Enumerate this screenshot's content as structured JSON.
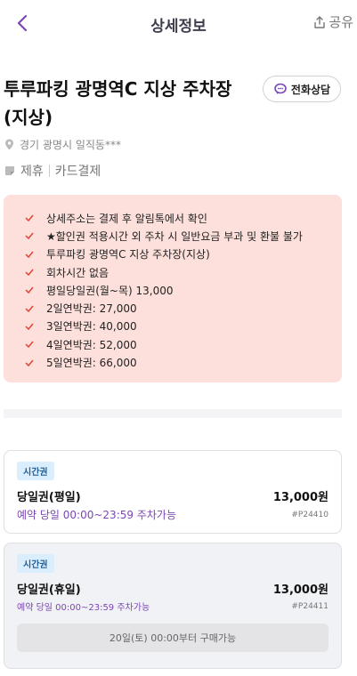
{
  "header": {
    "title": "상세정보",
    "share_label": "공유"
  },
  "lot": {
    "title_line1": "투루파킹 광명역C 지상 주차장",
    "title_line2": "(지상)",
    "call_label": "전화상담",
    "address": "경기 광명시 일직동***",
    "tags": [
      "제휴",
      "카드결제"
    ]
  },
  "notices": [
    "상세주소는 결제 후 알림톡에서 확인",
    "★할인권 적용시간 외 주차 시 일반요금 부과 및 환불 불가",
    "투루파킹 광명역C 지상 주차장(지상)",
    "회차시간 없음",
    "평일당일권(월~목) 13,000",
    "2일연박권: 27,000",
    "3일연박권: 40,000",
    "4일연박권: 52,000",
    "5일연박권: 66,000"
  ],
  "tickets": [
    {
      "chip": "시간권",
      "name": "당일권(평일)",
      "price": "13,000원",
      "time": "예약 당일 00:00~23:59 주차가능",
      "code": "#P24410"
    },
    {
      "chip": "시간권",
      "name": "당일권(휴일)",
      "price": "13,000원",
      "time": "예약 당일 00:00~23:59 주차가능",
      "code": "#P24411",
      "button": "20일(토) 00:00부터 구매가능"
    }
  ],
  "colors": {
    "accent": "#7b46b5",
    "notice_bg": "#fde0db",
    "check": "#e0452f",
    "chip_bg": "#dbeefd"
  }
}
